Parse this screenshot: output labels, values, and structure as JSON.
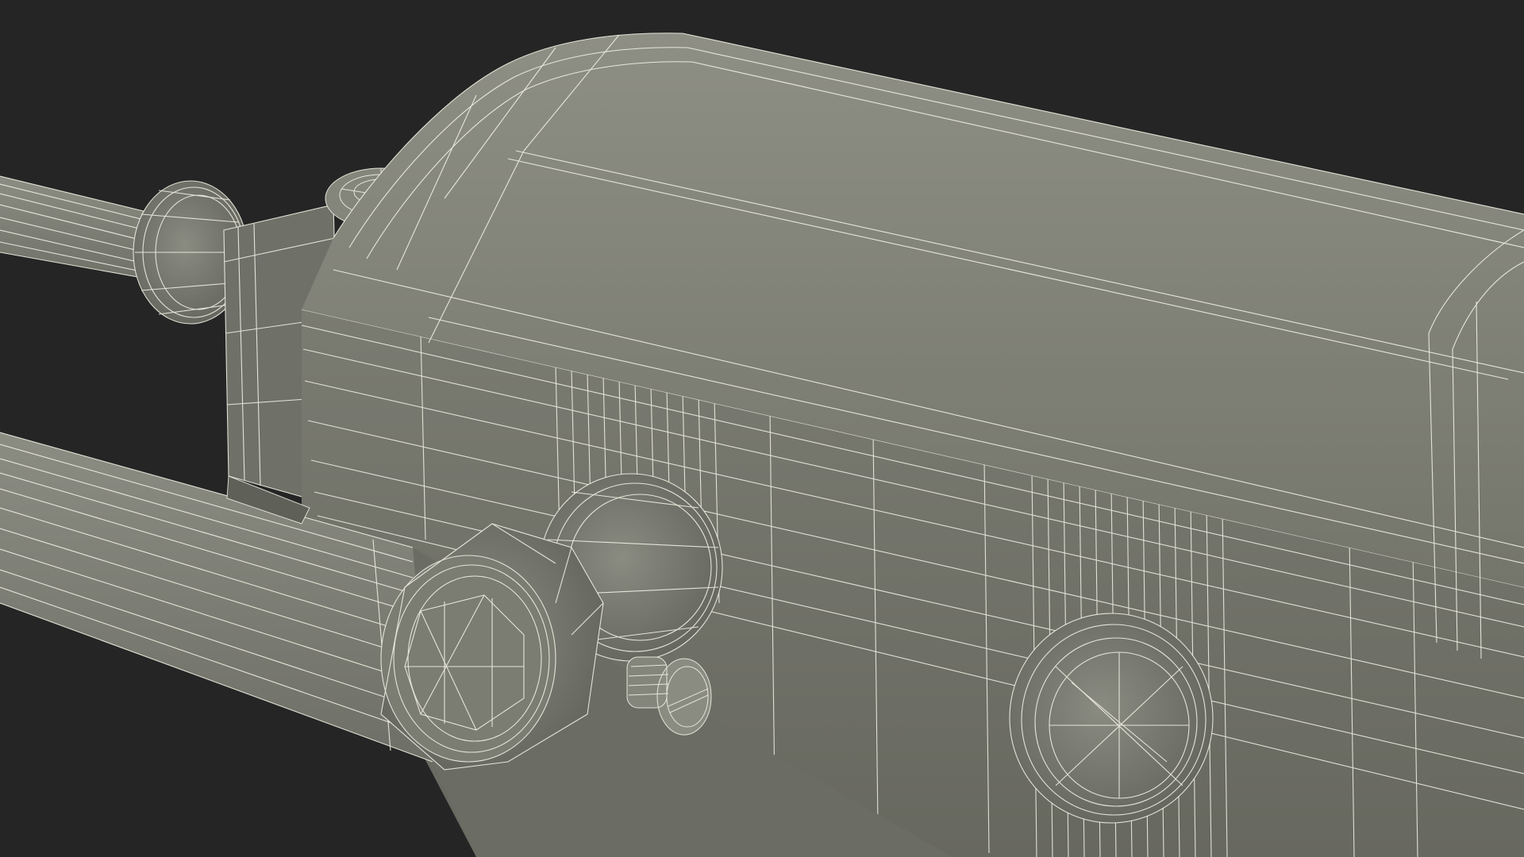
{
  "colors": {
    "background": "#252525",
    "surface_light": "#8a8b80",
    "surface_mid": "#7b7c72",
    "surface_dark": "#63645c",
    "wire": "#f1f0e4"
  },
  "objects": [
    "actuator-housing",
    "housing-lid",
    "actuator-rod-upper",
    "actuator-rod-lower",
    "hex-nut-front",
    "hex-nut-rear",
    "mount-collar",
    "round-boss",
    "slotted-screw",
    "top-screw"
  ]
}
